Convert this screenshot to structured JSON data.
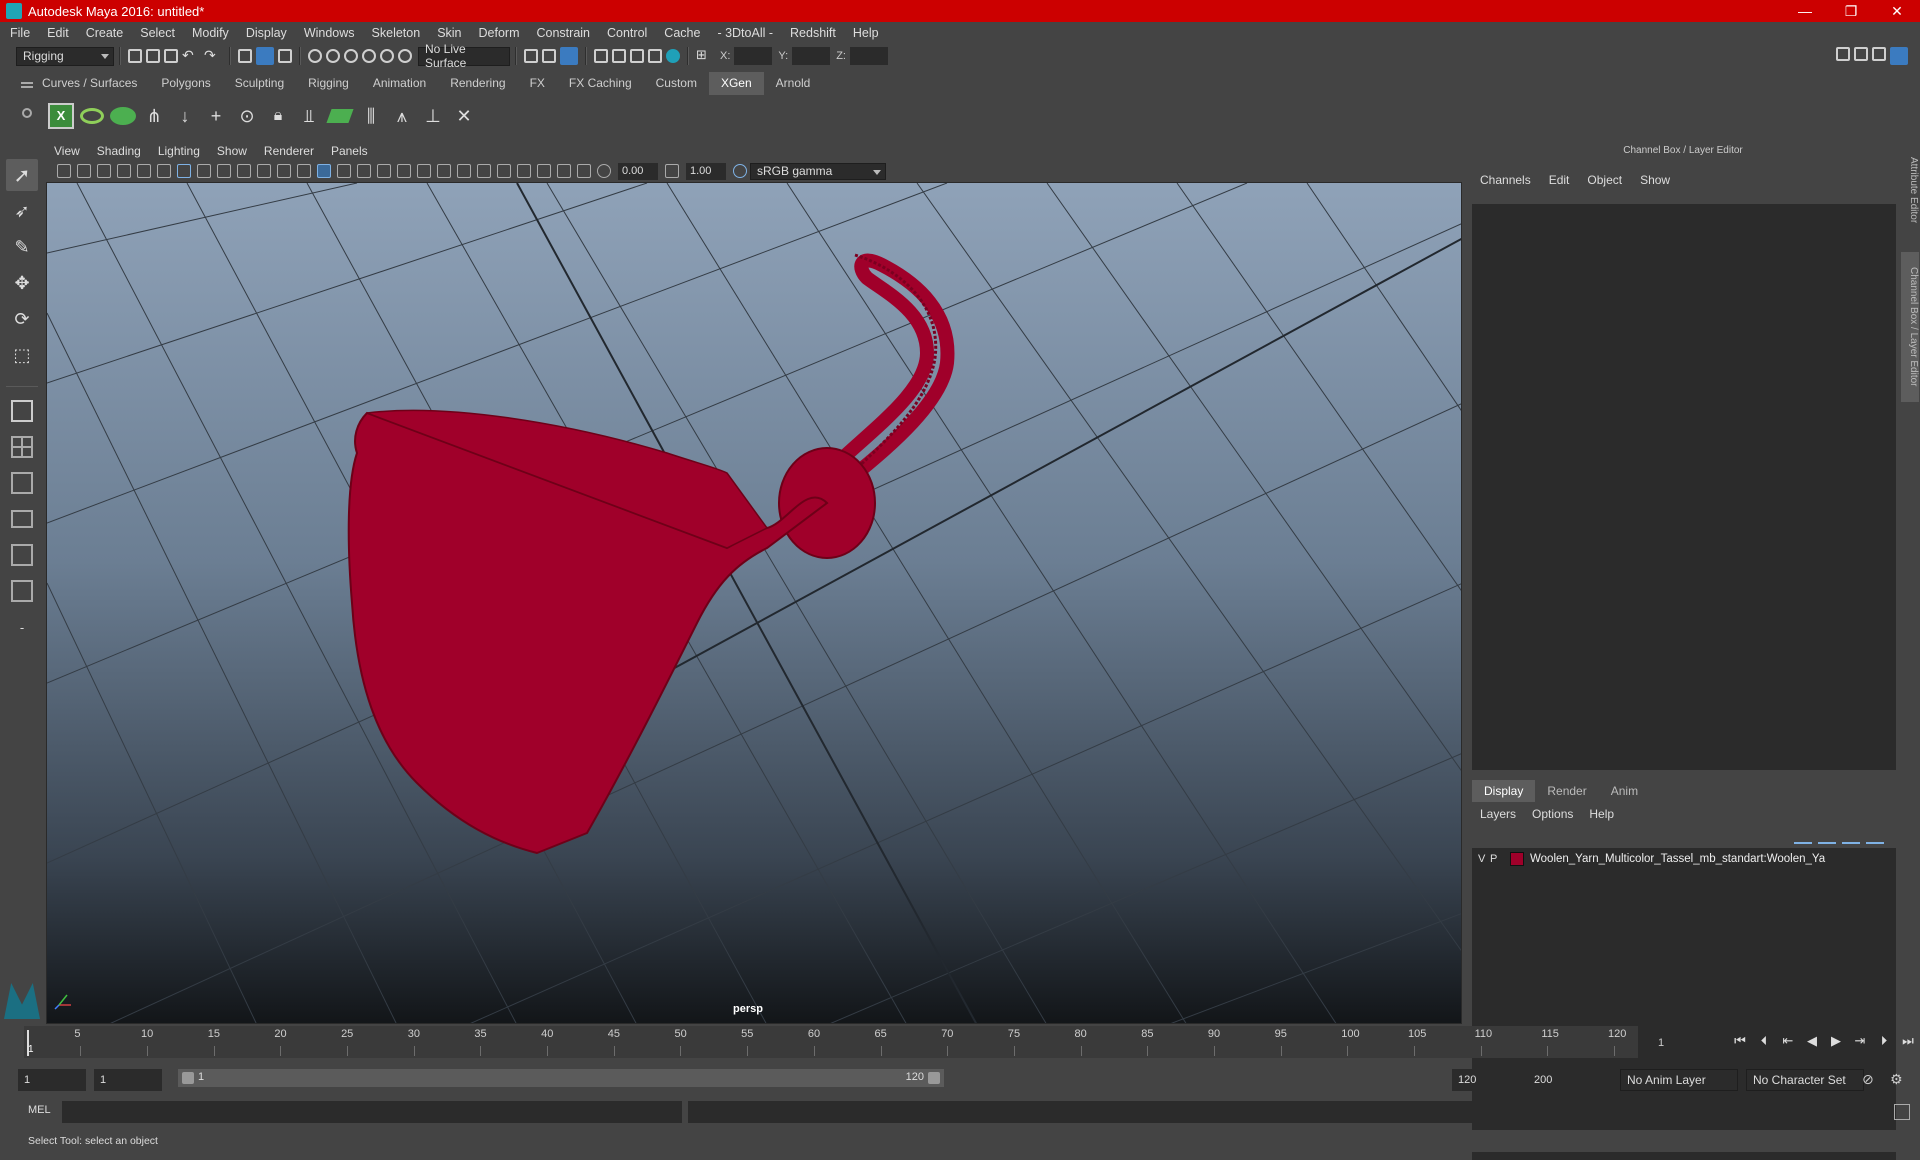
{
  "window": {
    "title": "Autodesk Maya 2016: untitled*",
    "controls": [
      "—",
      "❐",
      "✕"
    ]
  },
  "menubar": [
    "File",
    "Edit",
    "Create",
    "Select",
    "Modify",
    "Display",
    "Windows",
    "Skeleton",
    "Skin",
    "Deform",
    "Constrain",
    "Control",
    "Cache",
    "- 3DtoAll -",
    "Redshift",
    "Help"
  ],
  "statusline": {
    "menuset": "Rigging",
    "live_surface": "No Live Surface",
    "x_label": "X:",
    "y_label": "Y:",
    "z_label": "Z:"
  },
  "shelf": {
    "tabs": [
      "Curves / Surfaces",
      "Polygons",
      "Sculpting",
      "Rigging",
      "Animation",
      "Rendering",
      "FX",
      "FX Caching",
      "Custom",
      "XGen",
      "Arnold"
    ],
    "active_tab": "XGen"
  },
  "viewport": {
    "menu": [
      "View",
      "Shading",
      "Lighting",
      "Show",
      "Renderer",
      "Panels"
    ],
    "exposure": "0.00",
    "gamma": "1.00",
    "color_space": "sRGB gamma",
    "camera": "persp",
    "wire_color": "#a0002a"
  },
  "channel_box": {
    "title": "Channel Box / Layer Editor",
    "menu": [
      "Channels",
      "Edit",
      "Object",
      "Show"
    ],
    "layer_tabs": [
      "Display",
      "Render",
      "Anim"
    ],
    "active_layer_tab": "Display",
    "layer_menu": [
      "Layers",
      "Options",
      "Help"
    ],
    "layers": [
      {
        "v": "V",
        "p": "P",
        "color": "#a0002a",
        "name": "Woolen_Yarn_Multicolor_Tassel_mb_standart:Woolen_Ya"
      }
    ]
  },
  "side_tabs": [
    "Attribute Editor",
    "Channel Box / Layer Editor"
  ],
  "timeslider": {
    "ticks": [
      5,
      10,
      15,
      20,
      25,
      30,
      35,
      40,
      45,
      50,
      55,
      60,
      65,
      70,
      75,
      80,
      85,
      90,
      95,
      100,
      105,
      110,
      115,
      120
    ],
    "current_frame": "1",
    "current_frame_field": "1"
  },
  "rangeslider": {
    "start_field": "1",
    "playback_start": "1",
    "range_start_label": "1",
    "range_end_label": "120",
    "playback_end": "120",
    "end_field": "200",
    "anim_layer": "No Anim Layer",
    "character_set": "No Character Set"
  },
  "cmdline": {
    "language": "MEL"
  },
  "helpline": "Select Tool: select an object"
}
